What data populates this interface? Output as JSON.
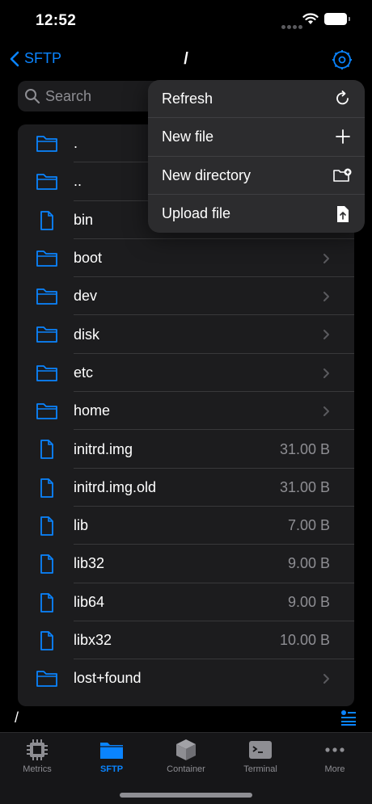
{
  "status_bar": {
    "time": "12:52"
  },
  "nav": {
    "back_label": "SFTP",
    "title": "/"
  },
  "search": {
    "placeholder": "Search"
  },
  "files": [
    {
      "name": ".",
      "type": "folder",
      "size": ""
    },
    {
      "name": "..",
      "type": "folder",
      "size": ""
    },
    {
      "name": "bin",
      "type": "file",
      "size": ""
    },
    {
      "name": "boot",
      "type": "folder",
      "size": ""
    },
    {
      "name": "dev",
      "type": "folder",
      "size": ""
    },
    {
      "name": "disk",
      "type": "folder",
      "size": ""
    },
    {
      "name": "etc",
      "type": "folder",
      "size": ""
    },
    {
      "name": "home",
      "type": "folder",
      "size": ""
    },
    {
      "name": "initrd.img",
      "type": "file",
      "size": "31.00 B"
    },
    {
      "name": "initrd.img.old",
      "type": "file",
      "size": "31.00 B"
    },
    {
      "name": "lib",
      "type": "file",
      "size": "7.00 B"
    },
    {
      "name": "lib32",
      "type": "file",
      "size": "9.00 B"
    },
    {
      "name": "lib64",
      "type": "file",
      "size": "9.00 B"
    },
    {
      "name": "libx32",
      "type": "file",
      "size": "10.00 B"
    },
    {
      "name": "lost+found",
      "type": "folder",
      "size": ""
    }
  ],
  "context_menu": {
    "items": [
      {
        "label": "Refresh",
        "icon": "refresh-icon"
      },
      {
        "label": "New file",
        "icon": "plus-icon"
      },
      {
        "label": "New directory",
        "icon": "folder-plus-icon"
      },
      {
        "label": "Upload file",
        "icon": "upload-file-icon"
      }
    ]
  },
  "path_bar": {
    "path": "/"
  },
  "tab_bar": {
    "tabs": [
      {
        "label": "Metrics",
        "icon": "cpu-icon",
        "active": false
      },
      {
        "label": "SFTP",
        "icon": "folder-icon",
        "active": true
      },
      {
        "label": "Container",
        "icon": "box-icon",
        "active": false
      },
      {
        "label": "Terminal",
        "icon": "terminal-icon",
        "active": false
      },
      {
        "label": "More",
        "icon": "ellipsis-icon",
        "active": false
      }
    ]
  },
  "colors": {
    "accent": "#0a84ff",
    "background": "#000000",
    "cell": "#1c1c1e",
    "menu": "#2c2c2e",
    "secondary_text": "#8e8e93"
  }
}
